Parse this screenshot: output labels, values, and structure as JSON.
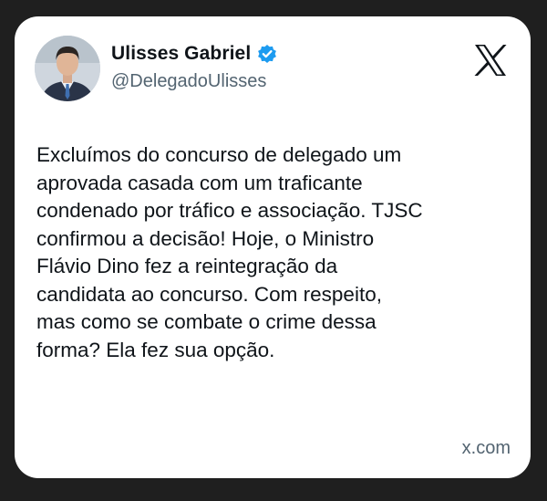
{
  "author": {
    "name": "Ulisses Gabriel",
    "handle": "@DelegadoUlisses",
    "verified_color": "#1d9bf0"
  },
  "tweet": {
    "text": "Excluímos do concurso de delegado um\naprovada casada com um traficante\ncondenado por tráfico e associação. TJSC\nconfirmou a decisão! Hoje, o Ministro\nFlávio Dino fez a reintegração da\ncandidata ao concurso. Com respeito,\nmas como se combate o crime dessa\nforma? Ela fez sua opção."
  },
  "footer": {
    "source": "x.com"
  },
  "icons": {
    "logo": "x-logo-icon",
    "verified": "verified-badge-icon",
    "avatar": "profile-photo"
  }
}
